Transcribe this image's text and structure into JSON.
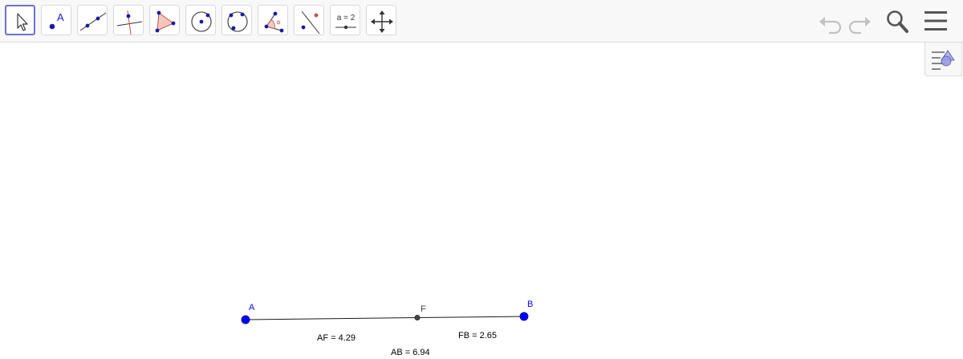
{
  "toolbar": {
    "tools": [
      {
        "name": "move-tool",
        "icon": "arrow-pointer-icon",
        "active": true
      },
      {
        "name": "point-tool",
        "icon": "point-icon",
        "glyph": "A"
      },
      {
        "name": "line-tool",
        "icon": "line-through-points-icon"
      },
      {
        "name": "perpendicular-line-tool",
        "icon": "perpendicular-line-icon"
      },
      {
        "name": "polygon-tool",
        "icon": "polygon-icon"
      },
      {
        "name": "circle-tool",
        "icon": "circle-center-point-icon"
      },
      {
        "name": "circle-three-points-tool",
        "icon": "circle-three-points-icon"
      },
      {
        "name": "angle-tool",
        "icon": "angle-icon"
      },
      {
        "name": "reflect-tool",
        "icon": "reflect-about-line-icon"
      },
      {
        "name": "slider-tool",
        "icon": "slider-icon",
        "glyph": "a = 2"
      },
      {
        "name": "move-graphics-view-tool",
        "icon": "move-arrows-icon"
      }
    ],
    "right": {
      "undo": "undo-icon",
      "redo": "redo-icon",
      "search": "search-icon",
      "menu": "hamburger-menu-icon"
    }
  },
  "algebra_toggle": "algebra-view-toggle-icon",
  "construction": {
    "points": [
      {
        "id": "A",
        "label": "A",
        "color": "#0000ff"
      },
      {
        "id": "F",
        "label": "F",
        "color": "#444444"
      },
      {
        "id": "B",
        "label": "B",
        "color": "#0000ff"
      }
    ],
    "measurements": {
      "af": "AF = 4.29",
      "fb": "FB = 2.65",
      "ab": "AB = 6.94"
    }
  },
  "colors": {
    "free_point": "#0000ff",
    "dependent_point": "#444444",
    "active_tool_border": "#6e6fd6",
    "polygon_fill": "#f4c7be",
    "polygon_stroke": "#c0504d"
  }
}
